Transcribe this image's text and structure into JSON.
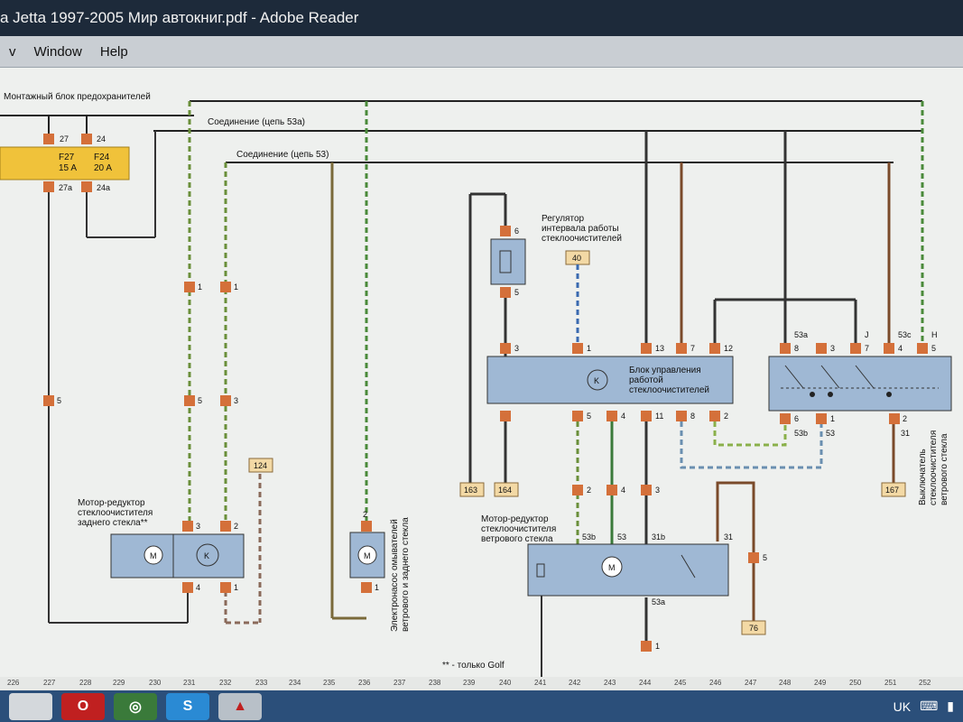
{
  "window": {
    "title": "a Jetta 1997-2005 Мир автокниг.pdf - Adobe Reader"
  },
  "menu": {
    "items": [
      "v",
      "Window",
      "Help"
    ]
  },
  "diagram": {
    "fuse_block_label": "Монтажный блок предохранителей",
    "fuse1": {
      "top_pin": "27",
      "name": "F27",
      "rating": "15 A",
      "bottom_pin": "27a"
    },
    "fuse2": {
      "top_pin": "24",
      "name": "F24",
      "rating": "20 A",
      "bottom_pin": "24a"
    },
    "connection_53a": "Соединение (цепь 53a)",
    "connection_53": "Соединение (цепь 53)",
    "interval_regulator": [
      "Регулятор",
      "интервала работы",
      "стеклоочистителей"
    ],
    "control_unit": [
      "Блок управления",
      "работой",
      "стеклоочистителей"
    ],
    "rear_motor": [
      "Мотор-редуктор",
      "стеклоочистителя",
      "заднего стекла**"
    ],
    "front_motor": [
      "Мотор-редуктор",
      "стеклоочистителя",
      "ветрового стекла"
    ],
    "washer_pump": [
      "Электронасос омывателей",
      "ветрового и заднего стекла"
    ],
    "wiper_switch": [
      "Выключатель",
      "стеклоочистителя",
      "ветрового стекла"
    ],
    "footnote": "** - только Golf",
    "refs": [
      "124",
      "40",
      "163",
      "164",
      "167",
      "76"
    ],
    "pins": {
      "a1": "1",
      "a5": "5",
      "b1": "1",
      "b5": "5",
      "b3": "3",
      "c5": "5",
      "c3": "3",
      "r3": "3",
      "r2": "2",
      "r4": "4",
      "r1": "1",
      "p2": "2",
      "p1": "1",
      "reg6": "6",
      "reg5": "5",
      "cu3": "3",
      "cu1": "1",
      "cu13": "13",
      "cu7": "7",
      "cu12": "12",
      "cu5": "5",
      "cu4": "4",
      "cu11": "11",
      "cu8": "8",
      "cu2": "2",
      "sw8": "8",
      "sw3": "3",
      "sw7": "7",
      "sw4": "4",
      "sw5": "5",
      "sw53a": "53a",
      "swJ": "J",
      "sw53c": "53c",
      "swH": "H",
      "sw6": "6",
      "sw1": "1",
      "sw2": "2",
      "sw53b": "53b",
      "sw53": "53",
      "sw31": "31",
      "fm2": "2",
      "fm4": "4",
      "fm3": "3",
      "fm53b": "53b",
      "fm53": "53",
      "fm31b": "31b",
      "fm31": "31",
      "fm53a": "53a",
      "fm1": "1",
      "fm5": "5"
    }
  },
  "ruler": [
    "226",
    "227",
    "228",
    "229",
    "230",
    "231",
    "232",
    "233",
    "234",
    "235",
    "236",
    "237",
    "238",
    "239",
    "240",
    "241",
    "242",
    "243",
    "244",
    "245",
    "246",
    "247",
    "248",
    "249",
    "250",
    "251",
    "252"
  ],
  "taskbar": {
    "lang": "UK"
  },
  "colors": {
    "titlebar": "#1d2a3a",
    "fuse_block": "#f0c23a",
    "component_fill": "#9fb8d4",
    "connector": "#d4703a",
    "taskbar": "#2b4f7a"
  }
}
